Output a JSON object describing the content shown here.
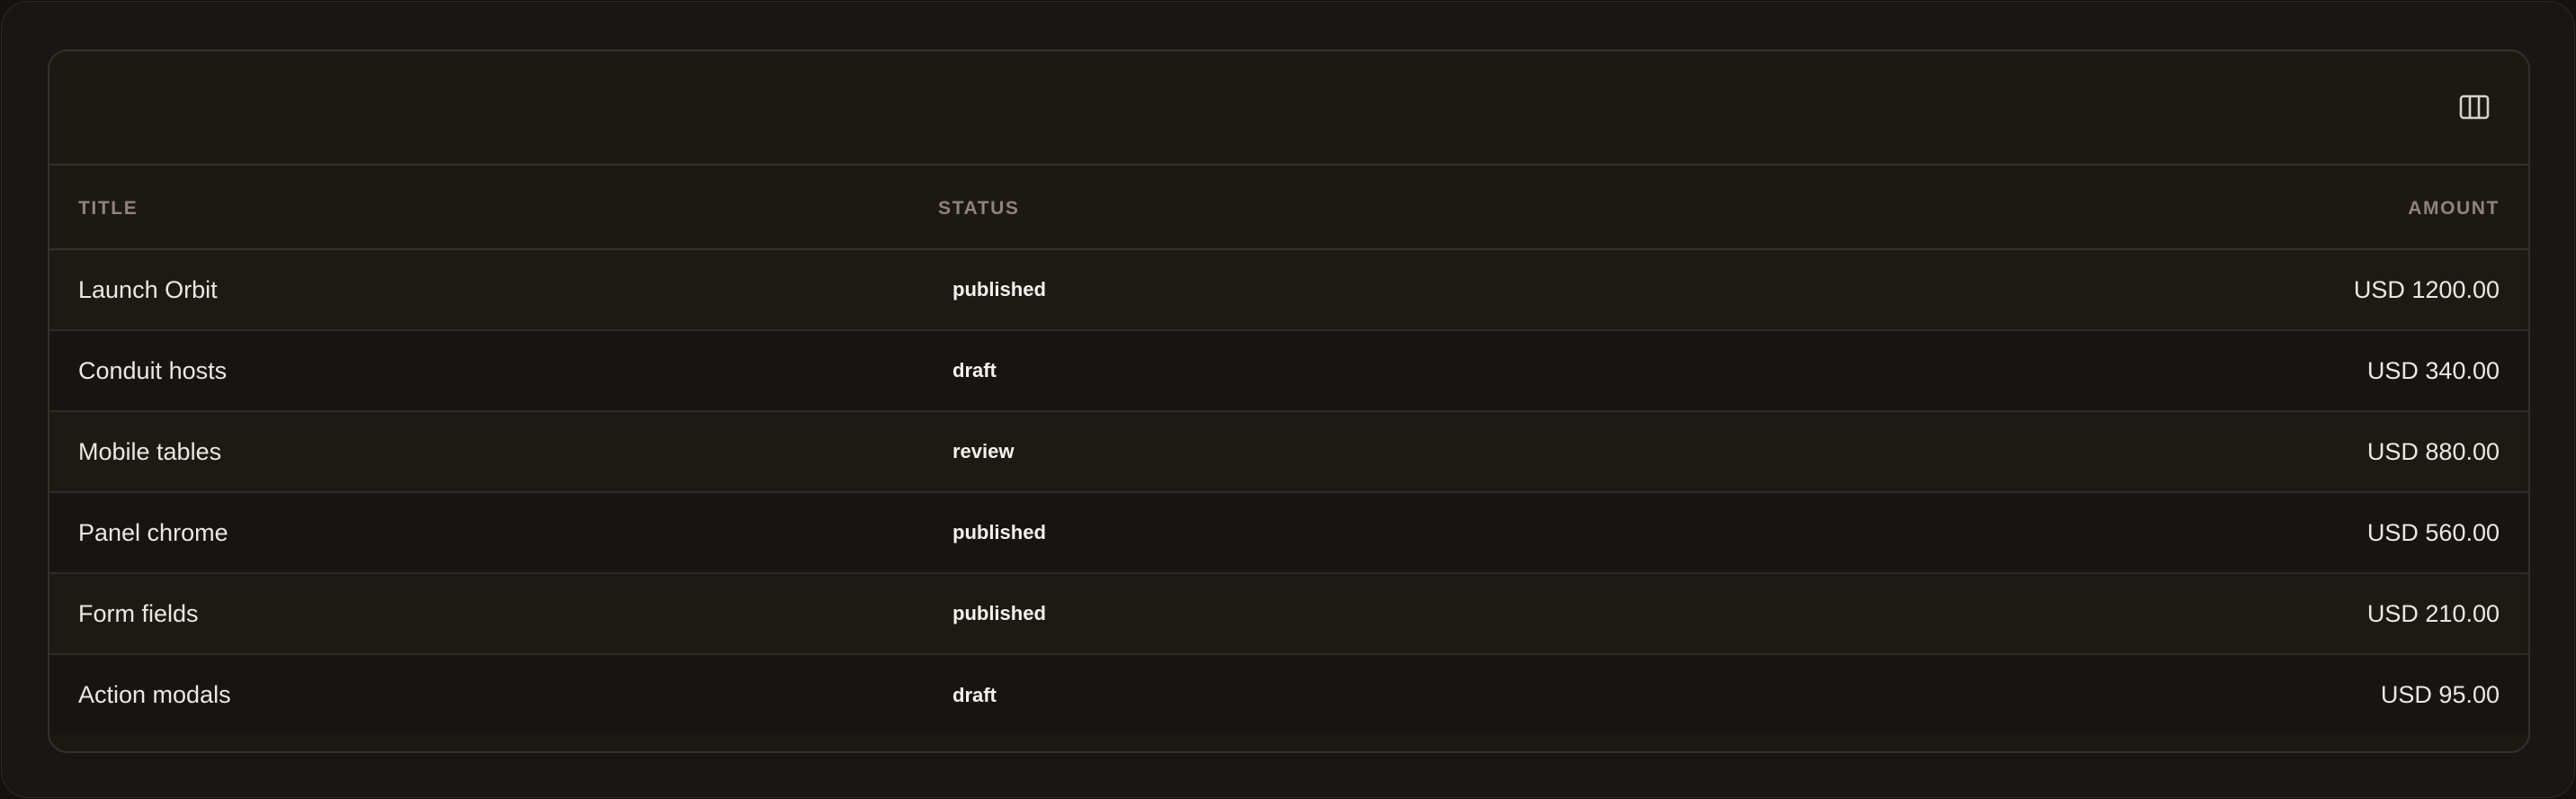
{
  "toolbar": {
    "columns_icon": "columns-icon"
  },
  "table": {
    "headers": {
      "title": "TITLE",
      "status": "STATUS",
      "amount": "AMOUNT"
    },
    "rows": [
      {
        "title": "Launch Orbit",
        "status": "published",
        "amount": "USD 1200.00"
      },
      {
        "title": "Conduit hosts",
        "status": "draft",
        "amount": "USD 340.00"
      },
      {
        "title": "Mobile tables",
        "status": "review",
        "amount": "USD 880.00"
      },
      {
        "title": "Panel chrome",
        "status": "published",
        "amount": "USD 560.00"
      },
      {
        "title": "Form fields",
        "status": "published",
        "amount": "USD 210.00"
      },
      {
        "title": "Action modals",
        "status": "draft",
        "amount": "USD 95.00"
      }
    ]
  },
  "colors": {
    "background": "#1a1613",
    "border": "#35302b",
    "text": "#ece7e2",
    "muted": "#8d847c"
  }
}
